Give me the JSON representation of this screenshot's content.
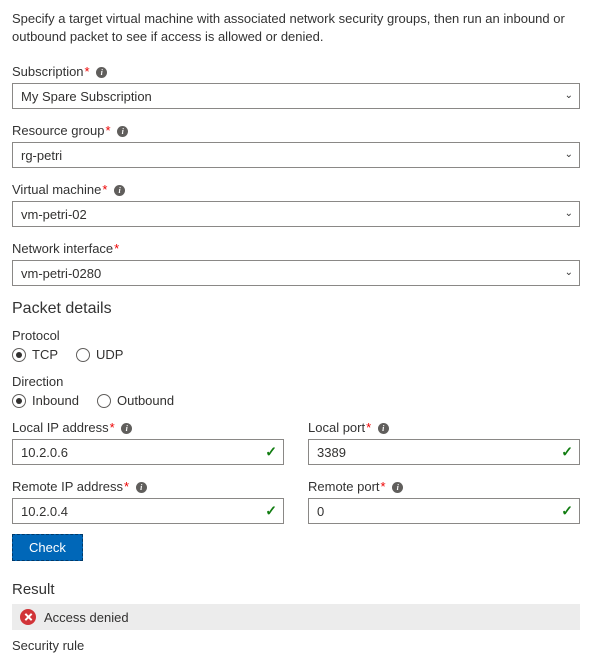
{
  "intro": "Specify a target virtual machine with associated network security groups, then run an inbound or outbound packet to see if access is allowed or denied.",
  "fields": {
    "subscription": {
      "label": "Subscription",
      "value": "My Spare Subscription"
    },
    "resourceGroup": {
      "label": "Resource group",
      "value": "rg-petri"
    },
    "vm": {
      "label": "Virtual machine",
      "value": "vm-petri-02"
    },
    "nic": {
      "label": "Network interface",
      "value": "vm-petri-0280"
    }
  },
  "packet": {
    "title": "Packet details",
    "protocolLabel": "Protocol",
    "protocolOptions": {
      "tcp": "TCP",
      "udp": "UDP"
    },
    "directionLabel": "Direction",
    "directionOptions": {
      "inbound": "Inbound",
      "outbound": "Outbound"
    },
    "localIp": {
      "label": "Local IP address",
      "value": "10.2.0.6"
    },
    "localPort": {
      "label": "Local port",
      "value": "3389"
    },
    "remoteIp": {
      "label": "Remote IP address",
      "value": "10.2.0.4"
    },
    "remotePort": {
      "label": "Remote port",
      "value": "0"
    }
  },
  "checkBtn": "Check",
  "result": {
    "title": "Result",
    "status": "Access denied",
    "securityRuleLabel": "Security rule"
  }
}
